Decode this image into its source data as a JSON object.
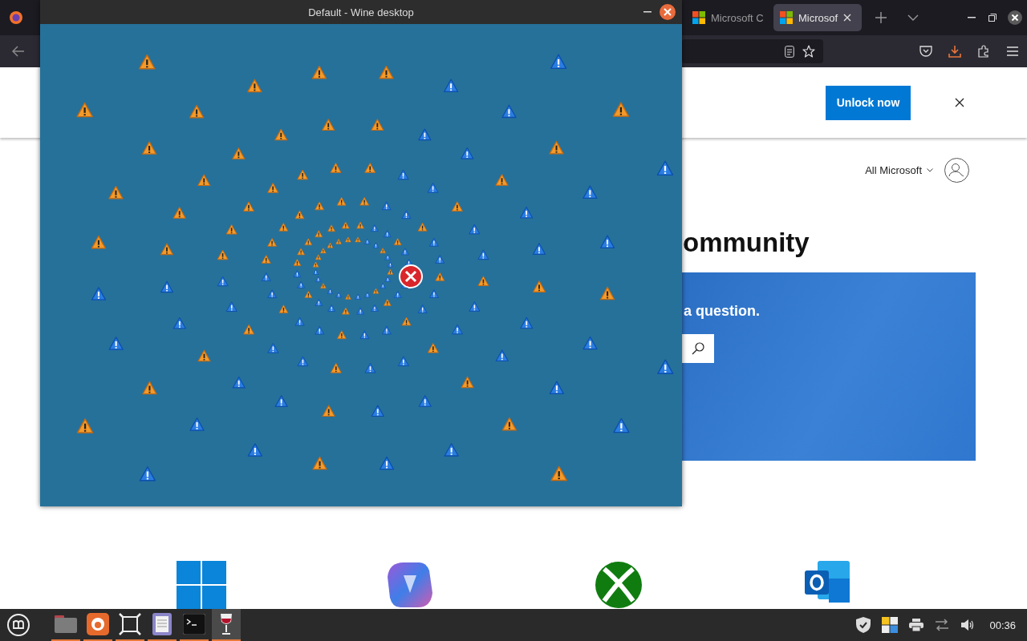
{
  "browser": {
    "tabs": [
      {
        "label": "Microsoft C",
        "selected": false
      },
      {
        "label": "Microsof",
        "selected": true
      }
    ],
    "banner": {
      "button": "Unlock now"
    },
    "header": {
      "menu": "All Microsoft"
    },
    "heading": "ommunity",
    "hero": {
      "text": "a question."
    }
  },
  "wine_window": {
    "title": "Default - Wine desktop"
  },
  "taskbar": {
    "apps": [
      {
        "kind": "files",
        "active": false
      },
      {
        "kind": "firefox",
        "active": false
      },
      {
        "kind": "apps",
        "active": false
      },
      {
        "kind": "editor",
        "active": false
      },
      {
        "kind": "terminal",
        "active": false
      },
      {
        "kind": "wine",
        "active": true
      }
    ],
    "clock": "00:36"
  }
}
